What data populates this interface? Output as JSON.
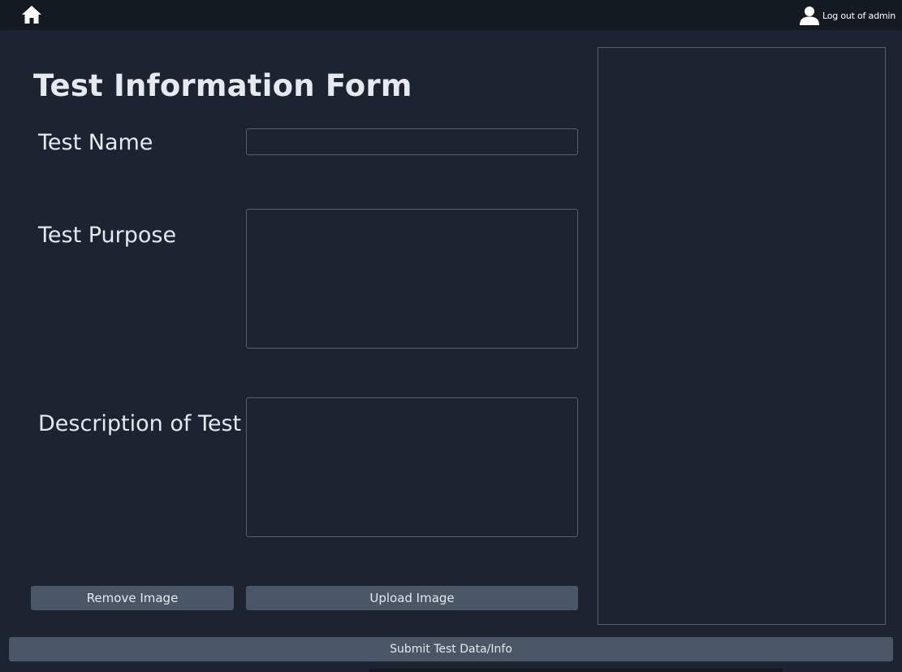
{
  "topbar": {
    "home_icon": "home-icon",
    "user_icon": "user-icon",
    "logout_label": "Log out of admin"
  },
  "form": {
    "title": "Test Information Form",
    "fields": {
      "test_name": {
        "label": "Test Name",
        "value": ""
      },
      "test_purpose": {
        "label": "Test Purpose",
        "value": ""
      },
      "description": {
        "label": "Description of Test",
        "value": ""
      }
    },
    "remove_image_label": "Remove Image",
    "upload_image_label": "Upload Image",
    "submit_label": "Submit Test Data/Info"
  },
  "colors": {
    "background": "#1b2430",
    "topbar": "#141a22",
    "button": "#4a5566",
    "border": "#56606c",
    "text": "#e6e9ee"
  }
}
